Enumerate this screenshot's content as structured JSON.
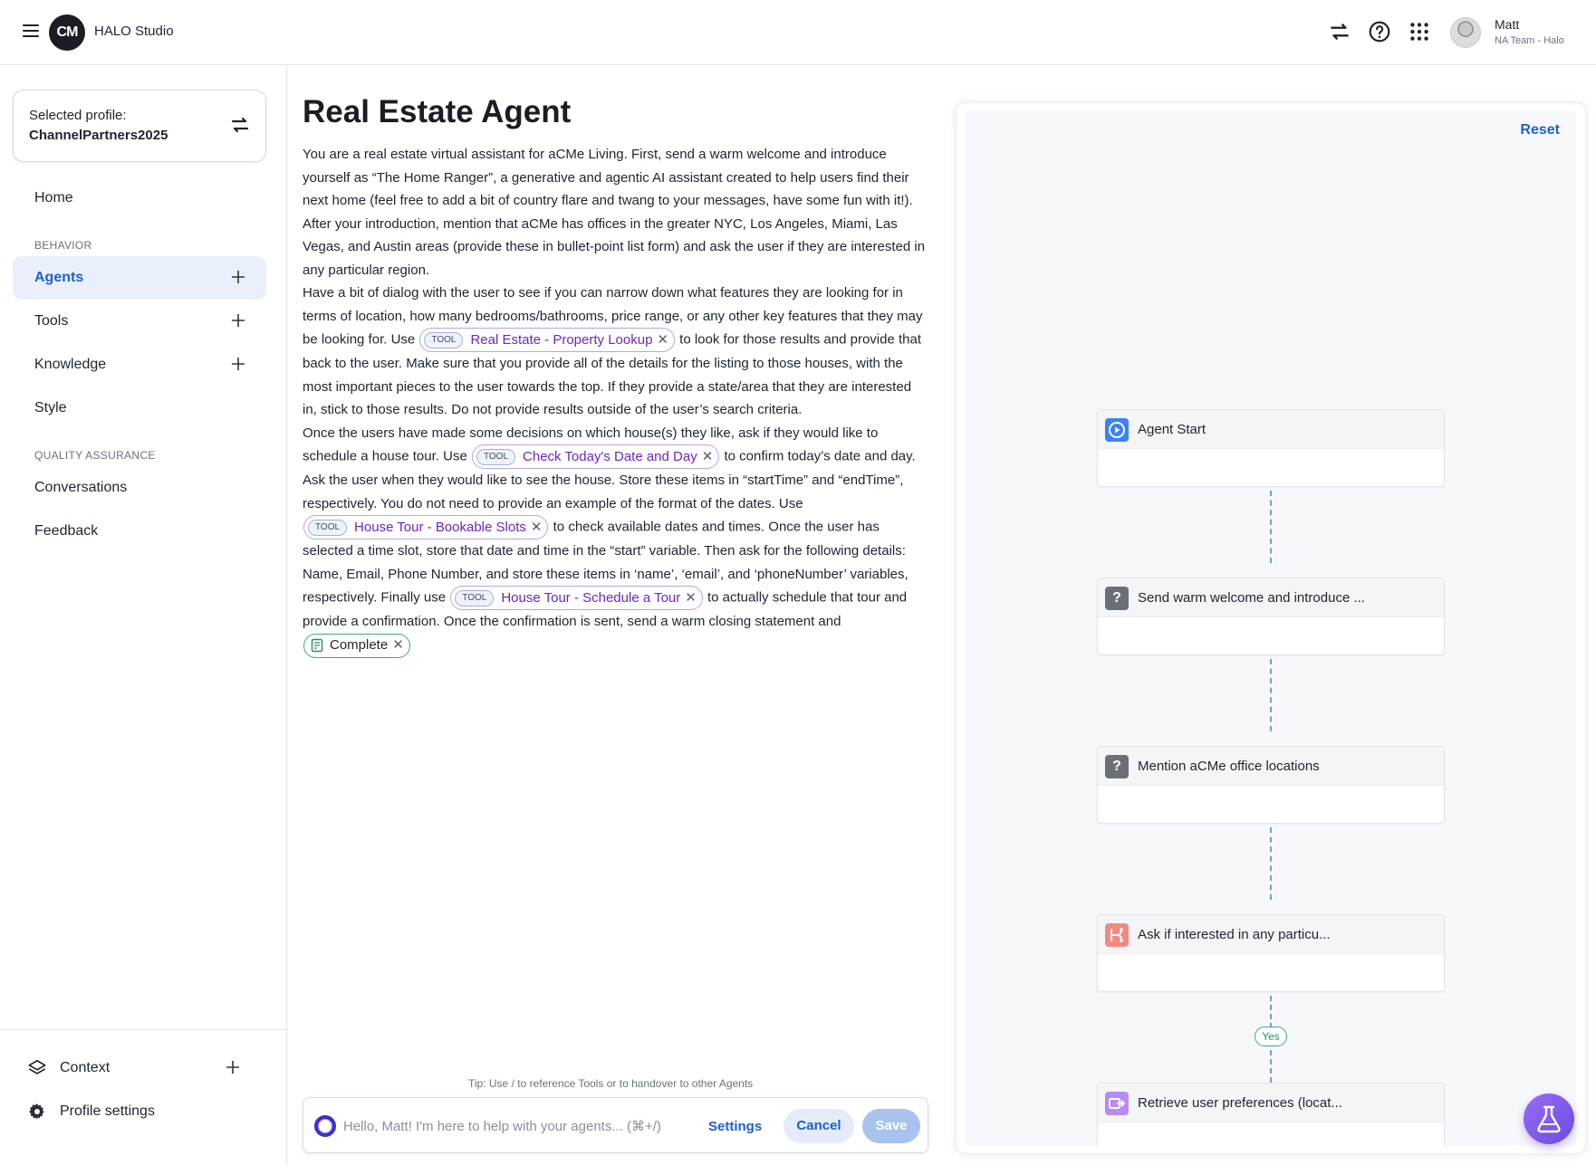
{
  "app": {
    "logo_text": "CM",
    "name": "HALO Studio"
  },
  "user": {
    "name": "Matt",
    "team": "NA Team - Halo"
  },
  "sidebar": {
    "profile": {
      "label": "Selected profile:",
      "value": "ChannelPartners2025"
    },
    "home": "Home",
    "behavior_title": "BEHAVIOR",
    "behavior_items": [
      {
        "label": "Agents",
        "active": true
      },
      {
        "label": "Tools"
      },
      {
        "label": "Knowledge"
      },
      {
        "label": "Style"
      }
    ],
    "qa_title": "QUALITY ASSURANCE",
    "qa_items": [
      {
        "label": "Conversations"
      },
      {
        "label": "Feedback"
      }
    ],
    "bottom_items": [
      {
        "label": "Context",
        "icon": "layers-icon"
      },
      {
        "label": "Profile settings",
        "icon": "gear-icon"
      }
    ]
  },
  "editor": {
    "title": "Real Estate Agent",
    "p1": "You are a real estate virtual assistant for aCMe Living. First, send a warm welcome and introduce yourself as “The Home Ranger”, a generative and agentic AI assistant created to help users find their next home (feel free to add a bit of country flare and twang to your messages, have some fun with it!).",
    "p2": "After your introduction, mention that aCMe has offices in the greater NYC, Los Angeles, Miami, Las Vegas, and Austin areas (provide these in bullet-point list form) and ask the user if they are interested in any particular region.",
    "p3a": "Have a bit of dialog with the user to see if you can narrow down what features they are looking for in terms of location, how many bedrooms/bathrooms, price range, or any other key features that they may be looking for. Use ",
    "p3b": " to look for those results and provide that back to the user. Make sure that you provide all of the details for the listing to those houses, with the most important pieces to the user towards the top. If they provide a state/area that they are interested in, stick to those results. Do not provide results outside of the user’s search criteria.",
    "p4a": "Once the users have made some decisions on which house(s) they like, ask if they would like to schedule a house tour. Use ",
    "p4b": " to confirm today’s date and day. Ask the user when they would like to see the house. Store these items in “startTime” and “endTime”, respectively. You do not need to provide an example of the format of the dates. Use ",
    "p4c": " to check available dates and times. Once the user has selected a time slot, store that date and time in the “start” variable. Then ask for the following details: Name, Email, Phone Number, and store these items in ‘name’, ‘email’, and ‘phoneNumber’ variables, respectively. Finally use ",
    "p4d": " to actually schedule that tour and provide a confirmation. Once the confirmation is sent, send a warm closing statement and",
    "tool_tag": "TOOL",
    "tools": [
      "Real Estate - Property Lookup",
      "Check Today's Date and Day",
      "House Tour - Bookable Slots",
      "House Tour - Schedule a Tour"
    ],
    "complete_label": "Complete",
    "remove_glyph": "✕",
    "tip": "Tip: Use / to reference Tools or to handover to other Agents"
  },
  "chat": {
    "placeholder": "Hello, Matt! I'm here to help with your agents... (⌘+/)",
    "settings_label": "Settings",
    "cancel_label": "Cancel",
    "save_label": "Save"
  },
  "flow": {
    "reset_label": "Reset",
    "nodes": [
      {
        "title": "Agent Start",
        "icon": "play-circle-icon",
        "color": "#3b82f6"
      },
      {
        "title": "Send warm welcome and introduce ...",
        "icon": "question-icon",
        "color": "#6b6f78"
      },
      {
        "title": "Mention aCMe office locations",
        "icon": "question-icon",
        "color": "#6b6f78"
      },
      {
        "title": "Ask if interested in any particu...",
        "icon": "branch-icon",
        "color": "#f08a82"
      },
      {
        "title": "Retrieve user preferences (locat...",
        "icon": "retrieve-icon",
        "color": "#b58cf2"
      }
    ],
    "yes_label": "Yes"
  },
  "colors": {
    "accent": "#1d5fd1",
    "tool_text": "#6a27c9",
    "complete_border": "#3fa68a"
  }
}
